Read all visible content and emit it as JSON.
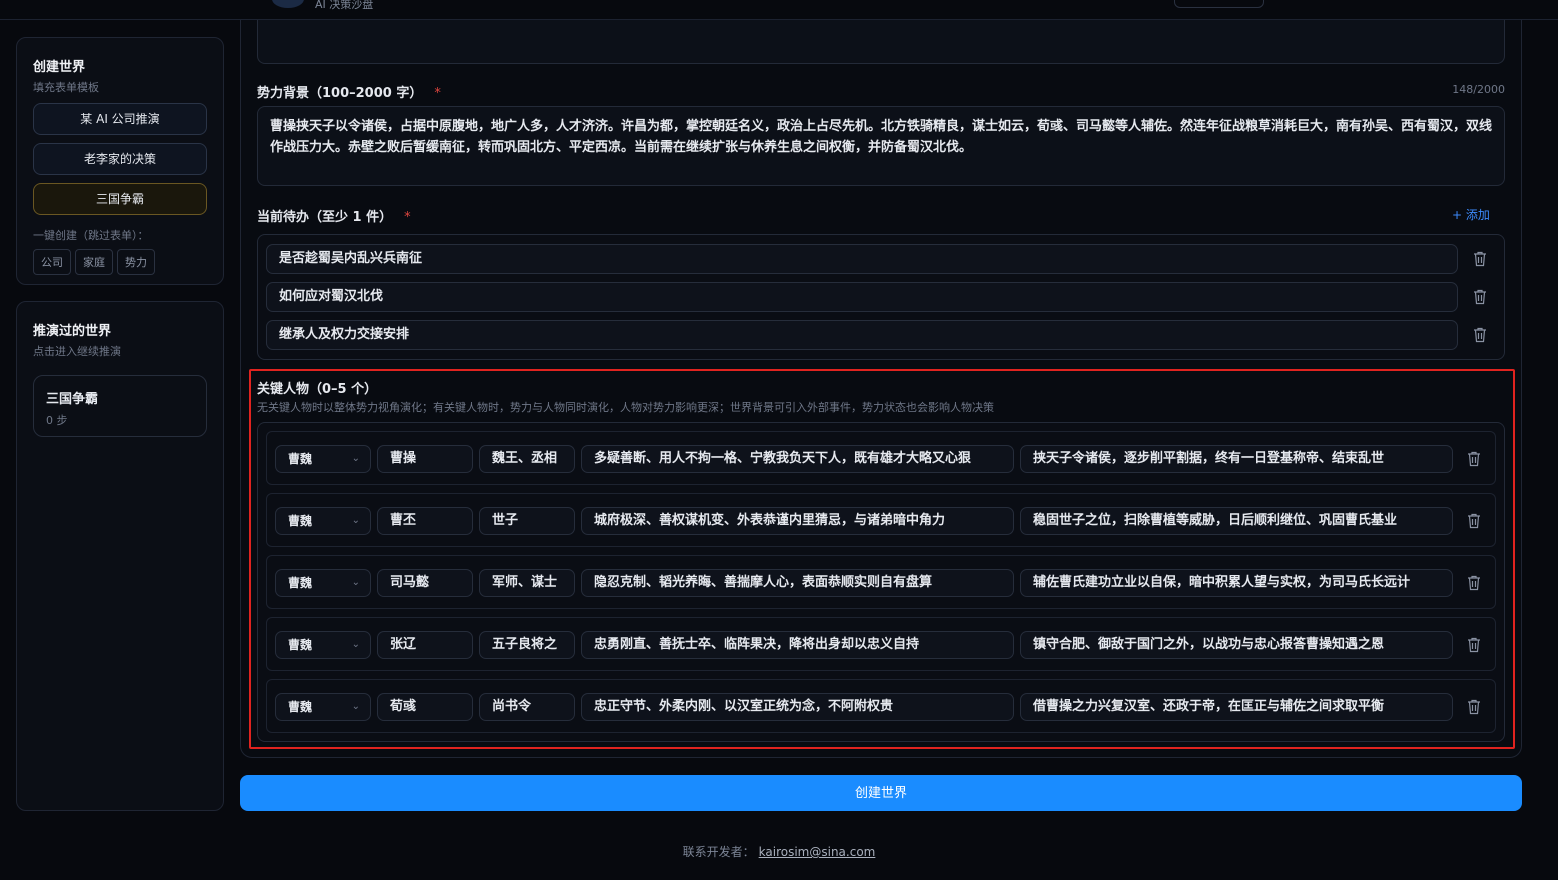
{
  "header": {
    "subtitle": "AI 决策沙盘"
  },
  "sidebar": {
    "create": {
      "title": "创建世界",
      "subtitle": "填充表单模板",
      "templates": [
        "某 AI 公司推演",
        "老李家的决策",
        "三国争霸"
      ],
      "active_template": "三国争霸",
      "quick_label": "一键创建（跳过表单）：",
      "quick_chips": [
        "公司",
        "家庭",
        "势力"
      ]
    },
    "history": {
      "title": "推演过的世界",
      "subtitle": "点击进入继续推演",
      "worlds": [
        {
          "name": "三国争霸",
          "steps": "0 步"
        }
      ]
    }
  },
  "form": {
    "background": {
      "label": "势力背景（100–2000 字）",
      "required_mark": "*",
      "counter": "148/2000",
      "value": "曹操挟天子以令诸侯，占据中原腹地，地广人多，人才济济。许昌为都，掌控朝廷名义，政治上占尽先机。北方铁骑精良，谋士如云，荀彧、司马懿等人辅佐。然连年征战粮草消耗巨大，南有孙吴、西有蜀汉，双线作战压力大。赤壁之败后暂缓南征，转而巩固北方、平定西凉。当前需在继续扩张与休养生息之间权衡，并防备蜀汉北伐。"
    },
    "todos": {
      "label": "当前待办（至少 1 件）",
      "required_mark": "*",
      "add_label": "+ 添加",
      "items": [
        "是否趁蜀吴内乱兴兵南征",
        "如何应对蜀汉北伐",
        "继承人及权力交接安排"
      ]
    },
    "key_persons": {
      "label": "关键人物（0–5 个）",
      "description": "无关键人物时以整体势力视角演化；有关键人物时，势力与人物同时演化，人物对势力影响更深；世界背景可引入外部事件，势力状态也会影响人物决策",
      "rows": [
        {
          "faction": "曹魏",
          "name": "曹操",
          "title": "魏王、丞相",
          "traits": "多疑善断、用人不拘一格、宁教我负天下人，既有雄才大略又心狠",
          "goal": "挟天子令诸侯，逐步削平割据，终有一日登基称帝、结束乱世"
        },
        {
          "faction": "曹魏",
          "name": "曹丕",
          "title": "世子",
          "traits": "城府极深、善权谋机变、外表恭谨内里猜忌，与诸弟暗中角力",
          "goal": "稳固世子之位，扫除曹植等威胁，日后顺利继位、巩固曹氏基业"
        },
        {
          "faction": "曹魏",
          "name": "司马懿",
          "title": "军师、谋士",
          "traits": "隐忍克制、韬光养晦、善揣摩人心，表面恭顺实则自有盘算",
          "goal": "辅佐曹氏建功立业以自保，暗中积累人望与实权，为司马氏长远计"
        },
        {
          "faction": "曹魏",
          "name": "张辽",
          "title": "五子良将之",
          "traits": "忠勇刚直、善抚士卒、临阵果决，降将出身却以忠义自持",
          "goal": "镇守合肥、御敌于国门之外，以战功与忠心报答曹操知遇之恩"
        },
        {
          "faction": "曹魏",
          "name": "荀彧",
          "title": "尚书令",
          "traits": "忠正守节、外柔内刚、以汉室正统为念，不阿附权贵",
          "goal": "借曹操之力兴复汉室、还政于帝，在匡正与辅佐之间求取平衡"
        }
      ]
    },
    "submit_label": "创建世界"
  },
  "footer": {
    "label": "联系开发者：",
    "email": "kairosim@sina.com"
  },
  "colors": {
    "accent": "#1a8cff",
    "required": "#e0463f",
    "highlight_outline": "#e0231f",
    "active_template_border": "#6a5722"
  }
}
